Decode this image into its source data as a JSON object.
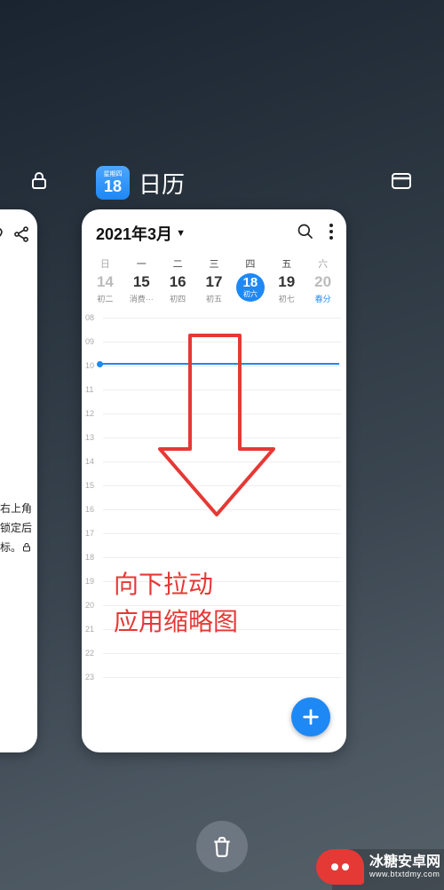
{
  "app": {
    "name": "日历",
    "icon_weekday": "星期四",
    "icon_day": "18"
  },
  "left_card": {
    "line1": "右上角",
    "line2": "锁定后",
    "line3": "标。"
  },
  "calendar": {
    "month_label": "2021年3月",
    "dow": [
      "日",
      "一",
      "二",
      "三",
      "四",
      "五",
      "六"
    ],
    "dates": [
      {
        "num": "14",
        "lunar": "初二",
        "dim": false
      },
      {
        "num": "15",
        "lunar": "消费···",
        "dim": false
      },
      {
        "num": "16",
        "lunar": "初四",
        "dim": false
      },
      {
        "num": "17",
        "lunar": "初五",
        "dim": false
      },
      {
        "num": "18",
        "lunar": "初六",
        "today": true
      },
      {
        "num": "19",
        "lunar": "初七",
        "dim": false
      },
      {
        "num": "20",
        "lunar": "春分",
        "dim": true,
        "accent": true
      }
    ],
    "hours": [
      "08",
      "09",
      "10",
      "11",
      "12",
      "13",
      "14",
      "15",
      "16",
      "17",
      "18",
      "19",
      "20",
      "21",
      "22",
      "23"
    ]
  },
  "annotation": {
    "line1": "向下拉动",
    "line2": "应用缩略图"
  },
  "watermark": {
    "brand": "冰糖安卓网",
    "url": "www.btxtdmy.com"
  }
}
